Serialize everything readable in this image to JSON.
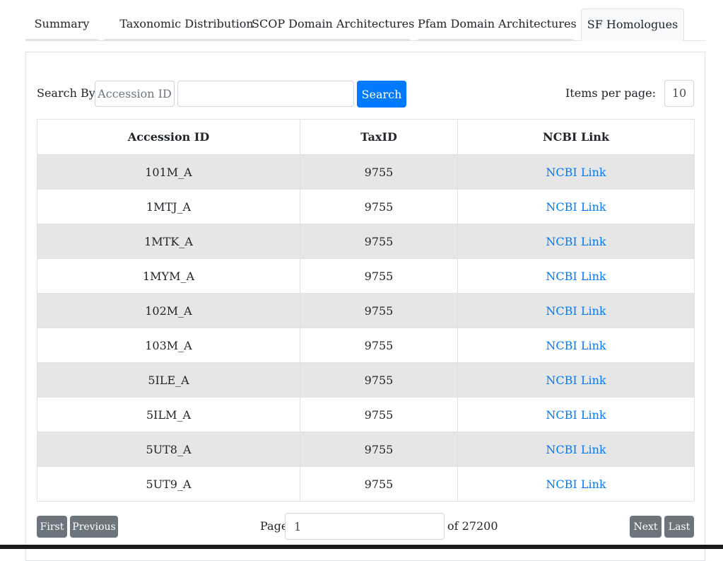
{
  "tabs": [
    {
      "label": "Summary"
    },
    {
      "label": "Taxonomic Distribution"
    },
    {
      "label": "SCOP Domain Architectures"
    },
    {
      "label": "Pfam Domain Architectures"
    },
    {
      "label": "SF Homologues"
    }
  ],
  "active_tab": "SF Homologues",
  "search": {
    "label": "Search By:",
    "field": "Accession ID",
    "input_value": "",
    "button": "Search"
  },
  "items_per_page": {
    "label": "Items per page:",
    "value": "10"
  },
  "table": {
    "headers": [
      "Accession ID",
      "TaxID",
      "NCBI Link"
    ],
    "rows": [
      {
        "accession": "101M_A",
        "taxid": "9755",
        "link": "NCBI Link"
      },
      {
        "accession": "1MTJ_A",
        "taxid": "9755",
        "link": "NCBI Link"
      },
      {
        "accession": "1MTK_A",
        "taxid": "9755",
        "link": "NCBI Link"
      },
      {
        "accession": "1MYM_A",
        "taxid": "9755",
        "link": "NCBI Link"
      },
      {
        "accession": "102M_A",
        "taxid": "9755",
        "link": "NCBI Link"
      },
      {
        "accession": "103M_A",
        "taxid": "9755",
        "link": "NCBI Link"
      },
      {
        "accession": "5ILE_A",
        "taxid": "9755",
        "link": "NCBI Link"
      },
      {
        "accession": "5ILM_A",
        "taxid": "9755",
        "link": "NCBI Link"
      },
      {
        "accession": "5UT8_A",
        "taxid": "9755",
        "link": "NCBI Link"
      },
      {
        "accession": "5UT9_A",
        "taxid": "9755",
        "link": "NCBI Link"
      }
    ]
  },
  "pagination": {
    "first": "First",
    "previous": "Previous",
    "page_label": "Page",
    "page_value": "1",
    "of_label": "of 27200",
    "next": "Next",
    "last": "Last"
  },
  "colors": {
    "primary": "#007bff",
    "secondary_button": "#6c757d",
    "striped_row": "#e6e6e6"
  }
}
